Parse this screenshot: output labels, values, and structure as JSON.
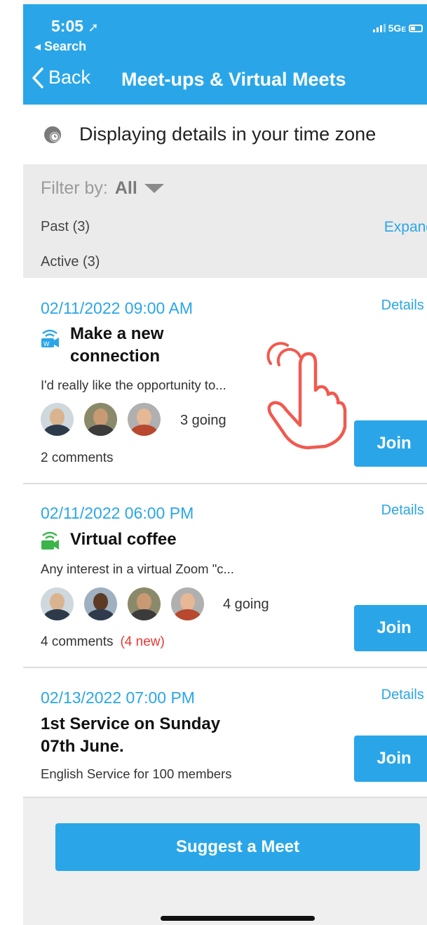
{
  "status": {
    "time": "5:05",
    "back_app": "◂ Search",
    "network": "5G",
    "network_suffix": "E"
  },
  "nav": {
    "back_label": "Back",
    "title": "Meet-ups & Virtual Meets"
  },
  "timezone": {
    "text": "Displaying details in your time zone",
    "icon": "clock-globe-icon"
  },
  "filter": {
    "label": "Filter by:",
    "value": "All"
  },
  "sections": {
    "past": "Past (3)",
    "expand": "Expand",
    "active": "Active (3)"
  },
  "meets": [
    {
      "date": "02/11/2022 09:00 AM",
      "details": "Details ›",
      "title_line1": "Make a new",
      "title_line2": "connection",
      "icon": "virtual-meet-icon",
      "description": "I'd really like the opportunity to...",
      "going": "3 going",
      "comments": "2 comments",
      "new_comments": "",
      "join": "Join"
    },
    {
      "date": "02/11/2022 06:00 PM",
      "details": "Details ›",
      "title_line1": "Virtual coffee",
      "title_line2": "",
      "icon": "zoom-wifi-icon",
      "description": "Any interest in a virtual Zoom \"c...",
      "going": "4 going",
      "comments": "4 comments",
      "new_comments": "(4 new)",
      "join": "Join"
    },
    {
      "date": "02/13/2022 07:00 PM",
      "details": "Details ›",
      "title_line1": "1st Service on Sunday",
      "title_line2": "07th June.",
      "icon": "",
      "description": "English Service for 100 members",
      "going": "",
      "comments": "",
      "new_comments": "",
      "join": "Join"
    }
  ],
  "suggest": {
    "label": "Suggest a Meet"
  },
  "colors": {
    "accent": "#2aa6e8",
    "new_badge": "#e53935",
    "hand_overlay": "#f05a4f"
  }
}
